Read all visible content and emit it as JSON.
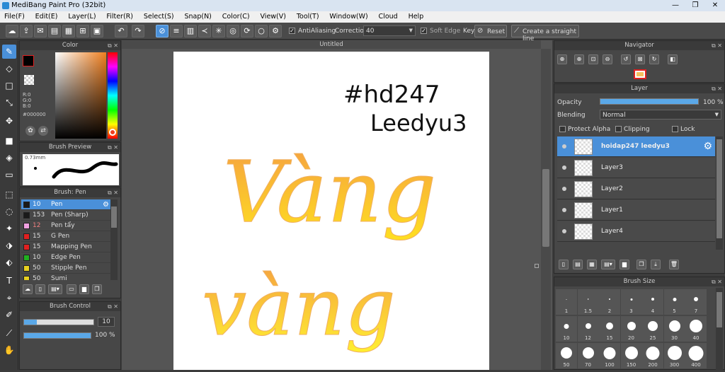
{
  "window": {
    "title": "MediBang Paint Pro (32bit)",
    "min": "—",
    "max": "❐",
    "close": "✕"
  },
  "menu": [
    "File(F)",
    "Edit(E)",
    "Layer(L)",
    "Filter(R)",
    "Select(S)",
    "Snap(N)",
    "Color(C)",
    "View(V)",
    "Tool(T)",
    "Window(W)",
    "Cloud",
    "Help"
  ],
  "toolbar": {
    "antialiasing": "AntiAliasing",
    "correction_label": "Correction",
    "correction_value": "40",
    "soft_edge": "Soft Edge",
    "key": "Key",
    "reset": "Reset",
    "straight_line": "Create a straight line"
  },
  "color_panel": {
    "title": "Color",
    "r": "R:0",
    "g": "G:0",
    "b": "B:0",
    "hex": "#000000"
  },
  "brush_preview": {
    "title": "Brush Preview",
    "size": "0.73mm"
  },
  "brush_panel": {
    "title": "Brush: Pen",
    "items": [
      {
        "size": "10",
        "name": "Pen",
        "color": "#1a1a1a"
      },
      {
        "size": "153",
        "name": "Pen (Sharp)",
        "color": "#1a1a1a"
      },
      {
        "size": "12",
        "name": "Pen tẩy",
        "color": "#f0a0e0"
      },
      {
        "size": "15",
        "name": "G Pen",
        "color": "#e02020"
      },
      {
        "size": "15",
        "name": "Mapping Pen",
        "color": "#e02020"
      },
      {
        "size": "10",
        "name": "Edge Pen",
        "color": "#20b020"
      },
      {
        "size": "50",
        "name": "Stipple Pen",
        "color": "#e8d020"
      },
      {
        "size": "50",
        "name": "Sumi",
        "color": "#e8d020"
      }
    ]
  },
  "brush_control": {
    "title": "Brush Control",
    "size": "10",
    "opacity": "100 %"
  },
  "canvas": {
    "tab": "Untitled",
    "text_hd": "#hd247",
    "text_user": "Leedyu3",
    "text_line1": "Vàng",
    "text_line2": "vàng",
    "stroke": "#f5a623"
  },
  "navigator": {
    "title": "Navigator"
  },
  "layer_panel": {
    "title": "Layer",
    "opacity_label": "Opacity",
    "opacity_value": "100 %",
    "blending_label": "Blending",
    "blending_value": "Normal",
    "protect_alpha": "Protect Alpha",
    "clipping": "Clipping",
    "lock": "Lock",
    "layers": [
      {
        "name": "hoidap247 leedyu3"
      },
      {
        "name": "Layer3"
      },
      {
        "name": "Layer2"
      },
      {
        "name": "Layer1"
      },
      {
        "name": "Layer4"
      }
    ]
  },
  "brush_size": {
    "title": "Brush Size",
    "sizes": [
      "1",
      "1.5",
      "2",
      "3",
      "4",
      "5",
      "7",
      "10",
      "12",
      "15",
      "20",
      "25",
      "30",
      "40",
      "50",
      "70",
      "100",
      "150",
      "200",
      "300",
      "400"
    ]
  }
}
